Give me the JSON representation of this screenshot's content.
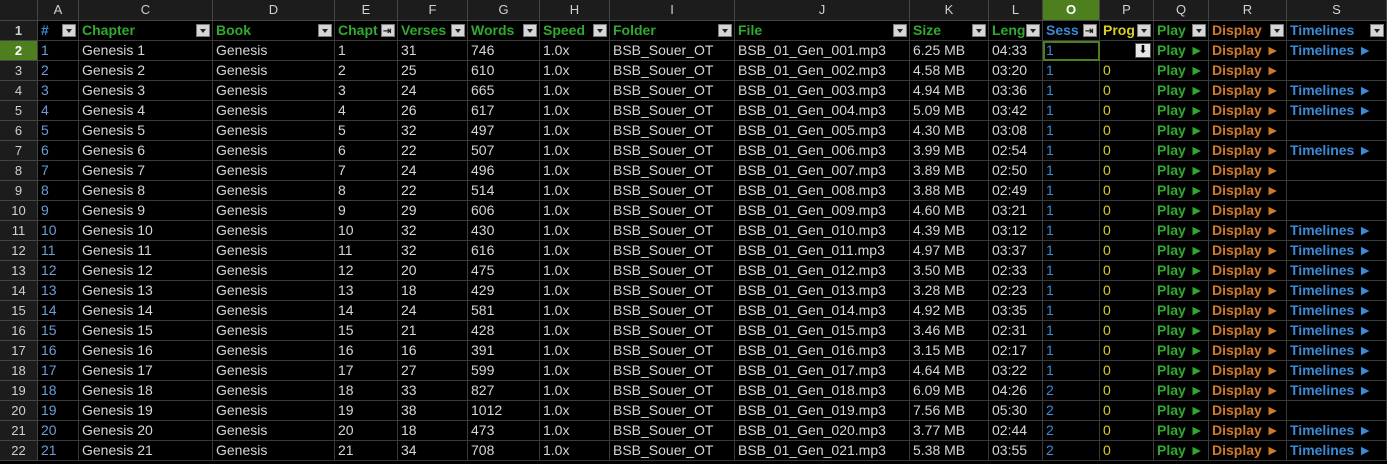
{
  "columns": [
    {
      "letter": "A",
      "width": 38
    },
    {
      "letter": "A",
      "width": 41
    },
    {
      "letter": "C",
      "width": 134
    },
    {
      "letter": "D",
      "width": 122
    },
    {
      "letter": "E",
      "width": 63
    },
    {
      "letter": "F",
      "width": 70
    },
    {
      "letter": "G",
      "width": 72
    },
    {
      "letter": "H",
      "width": 70
    },
    {
      "letter": "I",
      "width": 125
    },
    {
      "letter": "J",
      "width": 175
    },
    {
      "letter": "K",
      "width": 79
    },
    {
      "letter": "L",
      "width": 54
    },
    {
      "letter": "O",
      "width": 57
    },
    {
      "letter": "P",
      "width": 54
    },
    {
      "letter": "Q",
      "width": 55
    },
    {
      "letter": "R",
      "width": 78
    },
    {
      "letter": "S",
      "width": 100
    }
  ],
  "selected_column": "O",
  "selected_row": 2,
  "headers": {
    "id": {
      "label": "#",
      "color": "#3c8ad6"
    },
    "chapter": {
      "label": "Chapter",
      "color": "#2faa2f"
    },
    "book": {
      "label": "Book",
      "color": "#2faa2f"
    },
    "chapnum": {
      "label": "Chapt",
      "color": "#2faa2f"
    },
    "verses": {
      "label": "Verses",
      "color": "#2faa2f"
    },
    "words": {
      "label": "Words",
      "color": "#2faa2f"
    },
    "speed": {
      "label": "Speed",
      "color": "#2faa2f"
    },
    "folder": {
      "label": "Folder",
      "color": "#2faa2f"
    },
    "file": {
      "label": "File",
      "color": "#2faa2f"
    },
    "size": {
      "label": "Size",
      "color": "#2faa2f"
    },
    "length": {
      "label": "Leng",
      "color": "#2faa2f"
    },
    "sess": {
      "label": "Sess",
      "color": "#3c8ad6"
    },
    "prog": {
      "label": "Prog",
      "color": "#d8d020"
    },
    "play": {
      "label": "Play",
      "color": "#2faa2f"
    },
    "display": {
      "label": "Display",
      "color": "#d07b2a"
    },
    "timelines": {
      "label": "Timelines",
      "color": "#3c8ad6"
    }
  },
  "labels": {
    "play": "Play ►",
    "display": "Display ►",
    "timelines": "Timelines ►"
  },
  "rows": [
    {
      "row": 2,
      "id": "1",
      "chapter": "Genesis 1",
      "book": "Genesis",
      "chapnum": "1",
      "verses": "31",
      "words": "746",
      "speed": "1.0x",
      "folder": "BSB_Souer_OT",
      "file": "BSB_01_Gen_001.mp3",
      "size": "6.25 MB",
      "length": "04:33",
      "sess": "1",
      "prog": "",
      "timelines": true
    },
    {
      "row": 3,
      "id": "2",
      "chapter": "Genesis 2",
      "book": "Genesis",
      "chapnum": "2",
      "verses": "25",
      "words": "610",
      "speed": "1.0x",
      "folder": "BSB_Souer_OT",
      "file": "BSB_01_Gen_002.mp3",
      "size": "4.58 MB",
      "length": "03:20",
      "sess": "1",
      "prog": "0",
      "timelines": false
    },
    {
      "row": 4,
      "id": "3",
      "chapter": "Genesis 3",
      "book": "Genesis",
      "chapnum": "3",
      "verses": "24",
      "words": "665",
      "speed": "1.0x",
      "folder": "BSB_Souer_OT",
      "file": "BSB_01_Gen_003.mp3",
      "size": "4.94 MB",
      "length": "03:36",
      "sess": "1",
      "prog": "0",
      "timelines": true
    },
    {
      "row": 5,
      "id": "4",
      "chapter": "Genesis 4",
      "book": "Genesis",
      "chapnum": "4",
      "verses": "26",
      "words": "617",
      "speed": "1.0x",
      "folder": "BSB_Souer_OT",
      "file": "BSB_01_Gen_004.mp3",
      "size": "5.09 MB",
      "length": "03:42",
      "sess": "1",
      "prog": "0",
      "timelines": true
    },
    {
      "row": 6,
      "id": "5",
      "chapter": "Genesis 5",
      "book": "Genesis",
      "chapnum": "5",
      "verses": "32",
      "words": "497",
      "speed": "1.0x",
      "folder": "BSB_Souer_OT",
      "file": "BSB_01_Gen_005.mp3",
      "size": "4.30 MB",
      "length": "03:08",
      "sess": "1",
      "prog": "0",
      "timelines": false
    },
    {
      "row": 7,
      "id": "6",
      "chapter": "Genesis 6",
      "book": "Genesis",
      "chapnum": "6",
      "verses": "22",
      "words": "507",
      "speed": "1.0x",
      "folder": "BSB_Souer_OT",
      "file": "BSB_01_Gen_006.mp3",
      "size": "3.99 MB",
      "length": "02:54",
      "sess": "1",
      "prog": "0",
      "timelines": true
    },
    {
      "row": 8,
      "id": "7",
      "chapter": "Genesis 7",
      "book": "Genesis",
      "chapnum": "7",
      "verses": "24",
      "words": "496",
      "speed": "1.0x",
      "folder": "BSB_Souer_OT",
      "file": "BSB_01_Gen_007.mp3",
      "size": "3.89 MB",
      "length": "02:50",
      "sess": "1",
      "prog": "0",
      "timelines": false
    },
    {
      "row": 9,
      "id": "8",
      "chapter": "Genesis 8",
      "book": "Genesis",
      "chapnum": "8",
      "verses": "22",
      "words": "514",
      "speed": "1.0x",
      "folder": "BSB_Souer_OT",
      "file": "BSB_01_Gen_008.mp3",
      "size": "3.88 MB",
      "length": "02:49",
      "sess": "1",
      "prog": "0",
      "timelines": false
    },
    {
      "row": 10,
      "id": "9",
      "chapter": "Genesis 9",
      "book": "Genesis",
      "chapnum": "9",
      "verses": "29",
      "words": "606",
      "speed": "1.0x",
      "folder": "BSB_Souer_OT",
      "file": "BSB_01_Gen_009.mp3",
      "size": "4.60 MB",
      "length": "03:21",
      "sess": "1",
      "prog": "0",
      "timelines": false
    },
    {
      "row": 11,
      "id": "10",
      "chapter": "Genesis 10",
      "book": "Genesis",
      "chapnum": "10",
      "verses": "32",
      "words": "430",
      "speed": "1.0x",
      "folder": "BSB_Souer_OT",
      "file": "BSB_01_Gen_010.mp3",
      "size": "4.39 MB",
      "length": "03:12",
      "sess": "1",
      "prog": "0",
      "timelines": true
    },
    {
      "row": 12,
      "id": "11",
      "chapter": "Genesis 11",
      "book": "Genesis",
      "chapnum": "11",
      "verses": "32",
      "words": "616",
      "speed": "1.0x",
      "folder": "BSB_Souer_OT",
      "file": "BSB_01_Gen_011.mp3",
      "size": "4.97 MB",
      "length": "03:37",
      "sess": "1",
      "prog": "0",
      "timelines": true
    },
    {
      "row": 13,
      "id": "12",
      "chapter": "Genesis 12",
      "book": "Genesis",
      "chapnum": "12",
      "verses": "20",
      "words": "475",
      "speed": "1.0x",
      "folder": "BSB_Souer_OT",
      "file": "BSB_01_Gen_012.mp3",
      "size": "3.50 MB",
      "length": "02:33",
      "sess": "1",
      "prog": "0",
      "timelines": true
    },
    {
      "row": 14,
      "id": "13",
      "chapter": "Genesis 13",
      "book": "Genesis",
      "chapnum": "13",
      "verses": "18",
      "words": "429",
      "speed": "1.0x",
      "folder": "BSB_Souer_OT",
      "file": "BSB_01_Gen_013.mp3",
      "size": "3.28 MB",
      "length": "02:23",
      "sess": "1",
      "prog": "0",
      "timelines": true
    },
    {
      "row": 15,
      "id": "14",
      "chapter": "Genesis 14",
      "book": "Genesis",
      "chapnum": "14",
      "verses": "24",
      "words": "581",
      "speed": "1.0x",
      "folder": "BSB_Souer_OT",
      "file": "BSB_01_Gen_014.mp3",
      "size": "4.92 MB",
      "length": "03:35",
      "sess": "1",
      "prog": "0",
      "timelines": true
    },
    {
      "row": 16,
      "id": "15",
      "chapter": "Genesis 15",
      "book": "Genesis",
      "chapnum": "15",
      "verses": "21",
      "words": "428",
      "speed": "1.0x",
      "folder": "BSB_Souer_OT",
      "file": "BSB_01_Gen_015.mp3",
      "size": "3.46 MB",
      "length": "02:31",
      "sess": "1",
      "prog": "0",
      "timelines": true
    },
    {
      "row": 17,
      "id": "16",
      "chapter": "Genesis 16",
      "book": "Genesis",
      "chapnum": "16",
      "verses": "16",
      "words": "391",
      "speed": "1.0x",
      "folder": "BSB_Souer_OT",
      "file": "BSB_01_Gen_016.mp3",
      "size": "3.15 MB",
      "length": "02:17",
      "sess": "1",
      "prog": "0",
      "timelines": true
    },
    {
      "row": 18,
      "id": "17",
      "chapter": "Genesis 17",
      "book": "Genesis",
      "chapnum": "17",
      "verses": "27",
      "words": "599",
      "speed": "1.0x",
      "folder": "BSB_Souer_OT",
      "file": "BSB_01_Gen_017.mp3",
      "size": "4.64 MB",
      "length": "03:22",
      "sess": "1",
      "prog": "0",
      "timelines": true
    },
    {
      "row": 19,
      "id": "18",
      "chapter": "Genesis 18",
      "book": "Genesis",
      "chapnum": "18",
      "verses": "33",
      "words": "827",
      "speed": "1.0x",
      "folder": "BSB_Souer_OT",
      "file": "BSB_01_Gen_018.mp3",
      "size": "6.09 MB",
      "length": "04:26",
      "sess": "2",
      "prog": "0",
      "timelines": true
    },
    {
      "row": 20,
      "id": "19",
      "chapter": "Genesis 19",
      "book": "Genesis",
      "chapnum": "19",
      "verses": "38",
      "words": "1012",
      "speed": "1.0x",
      "folder": "BSB_Souer_OT",
      "file": "BSB_01_Gen_019.mp3",
      "size": "7.56 MB",
      "length": "05:30",
      "sess": "2",
      "prog": "0",
      "timelines": false
    },
    {
      "row": 21,
      "id": "20",
      "chapter": "Genesis 20",
      "book": "Genesis",
      "chapnum": "20",
      "verses": "18",
      "words": "473",
      "speed": "1.0x",
      "folder": "BSB_Souer_OT",
      "file": "BSB_01_Gen_020.mp3",
      "size": "3.77 MB",
      "length": "02:44",
      "sess": "2",
      "prog": "0",
      "timelines": true
    },
    {
      "row": 22,
      "id": "21",
      "chapter": "Genesis 21",
      "book": "Genesis",
      "chapnum": "21",
      "verses": "34",
      "words": "708",
      "speed": "1.0x",
      "folder": "BSB_Souer_OT",
      "file": "BSB_01_Gen_021.mp3",
      "size": "5.38 MB",
      "length": "03:55",
      "sess": "2",
      "prog": "0",
      "timelines": true
    }
  ]
}
